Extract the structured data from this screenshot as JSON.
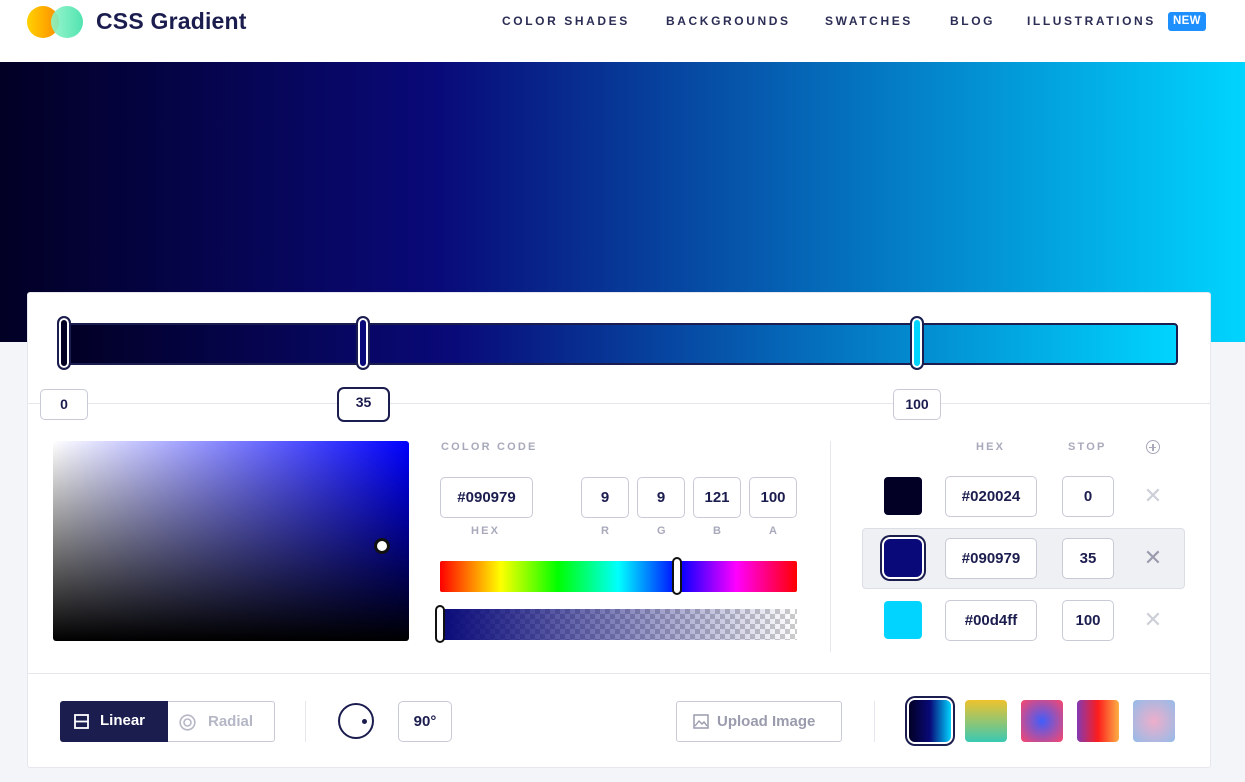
{
  "header": {
    "brand": "CSS Gradient",
    "nav": [
      "COLOR SHADES",
      "BACKGROUNDS",
      "SWATCHES",
      "BLOG",
      "ILLUSTRATIONS"
    ],
    "new_badge": "NEW"
  },
  "gradient": {
    "stops": [
      {
        "color": "#020024",
        "position": "0"
      },
      {
        "color": "#090979",
        "position": "35"
      },
      {
        "color": "#00d4ff",
        "position": "100"
      }
    ],
    "angle": "90°",
    "type_selected": "Linear"
  },
  "picker": {
    "section_label": "COLOR CODE",
    "hex": "#090979",
    "r": "9",
    "g": "9",
    "b": "121",
    "a": "100",
    "labels": {
      "hex": "HEX",
      "r": "R",
      "g": "G",
      "b": "B",
      "a": "A"
    },
    "hue_color": "#0000ff"
  },
  "stop_list": {
    "col_hex": "HEX",
    "col_stop": "STOP",
    "rows": [
      {
        "hex": "#020024",
        "stop": "0"
      },
      {
        "hex": "#090979",
        "stop": "35",
        "selected": true
      },
      {
        "hex": "#00d4ff",
        "stop": "100"
      }
    ],
    "remove_glyph": "✕"
  },
  "toolbar": {
    "linear_label": "Linear",
    "radial_label": "Radial",
    "angle_value": "90°",
    "upload_label": "Upload Image"
  },
  "presets": [
    {
      "name": "deep-blue-cyan",
      "colors": [
        "#020024",
        "#090979",
        "#00d4ff"
      ]
    },
    {
      "name": "yellow-teal",
      "colors": [
        "#eec22d",
        "#3ac9b4"
      ]
    },
    {
      "name": "blue-pink-radial",
      "colors": [
        "#3f5efb",
        "#fc466b"
      ]
    },
    {
      "name": "purple-red-yellow",
      "colors": [
        "#833ab4",
        "#fd1d1d",
        "#fcb045"
      ]
    },
    {
      "name": "pink-lavender-radial",
      "colors": [
        "#eeaeca",
        "#94bbe9"
      ]
    }
  ]
}
